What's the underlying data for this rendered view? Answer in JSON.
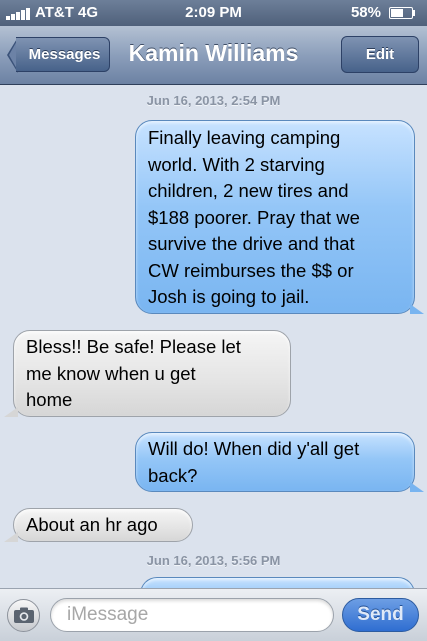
{
  "status_bar": {
    "carrier": "AT&T  4G",
    "time": "2:09 PM",
    "battery": "58%",
    "battery_level": 0.58
  },
  "nav_bar": {
    "back_label": "Messages",
    "title": "Kamin Williams",
    "edit_label": "Edit"
  },
  "conversation": {
    "timestamps": [
      "Jun 16, 2013, 2:54 PM",
      "Jun 16, 2013, 5:56 PM"
    ],
    "messages": [
      {
        "direction": "sent",
        "text": "Finally leaving camping\nworld. With 2 starving\nchildren, 2 new tires and\n$188 poorer. Pray that we\nsurvive the drive and that\nCW reimburses the $$ or\nJosh is going to jail."
      },
      {
        "direction": "received",
        "text": "Bless!! Be safe! Please let\nme know when u get\nhome"
      },
      {
        "direction": "sent",
        "text": "Will do! When did y'all get\nback?"
      },
      {
        "direction": "received",
        "text": "About an hr ago"
      }
    ]
  },
  "input_bar": {
    "placeholder": "iMessage",
    "send_label": "Send"
  },
  "colors": {
    "sent_bubble": "#8fc2f6",
    "received_bubble": "#e2e2e2",
    "nav_bar": "#8c9fbb",
    "send_button": "#3a76d6"
  }
}
